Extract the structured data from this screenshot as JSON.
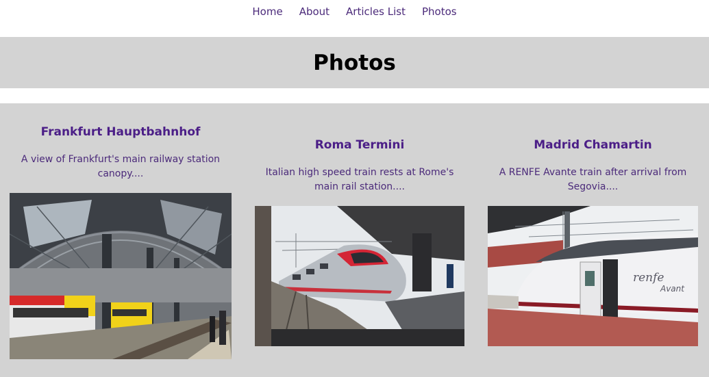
{
  "nav": {
    "items": [
      "Home",
      "About",
      "Articles List",
      "Photos"
    ]
  },
  "page": {
    "title": "Photos"
  },
  "photos": [
    {
      "title": "Frankfurt Hauptbahnhof",
      "description": "A view of Frankfurt's main railway station canopy....",
      "image": "frankfurt-station-photo"
    },
    {
      "title": "Roma Termini",
      "description": "Italian high speed train rests at Rome's main rail station....",
      "image": "roma-termini-photo"
    },
    {
      "title": "Madrid Chamartin",
      "description": "A RENFE Avante train after arrival from Segovia....",
      "image": "madrid-chamartin-photo"
    }
  ],
  "train_branding": {
    "logo": "renfe",
    "model": "Avant"
  }
}
